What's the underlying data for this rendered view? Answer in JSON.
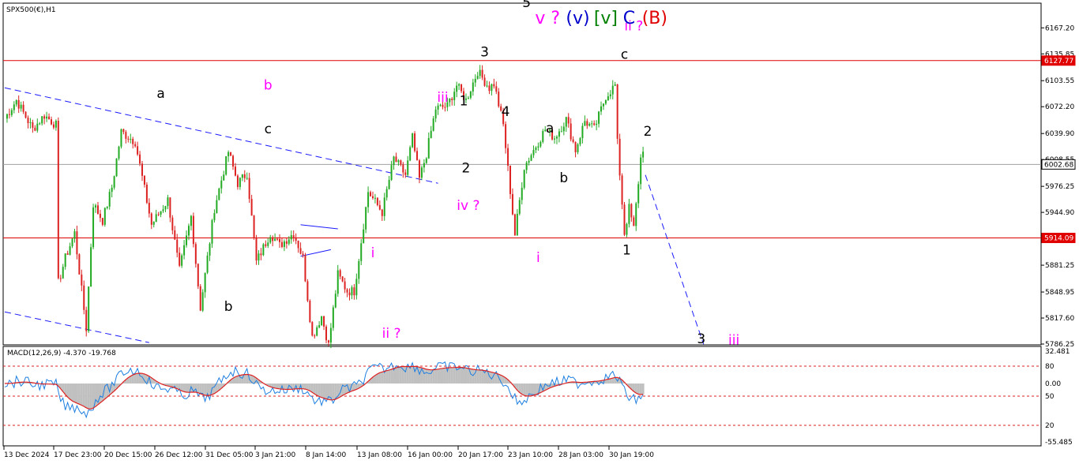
{
  "chart_data": {
    "type": "candlestick",
    "symbol_label": "SPX500(€),H1",
    "indicator_label": "MACD(12,26,9) -4.370 -19.768",
    "price_axis": {
      "ylim": [
        5786.25,
        6196.0
      ],
      "ticks": [
        "6167.20",
        "6135.85",
        "6103.55",
        "6072.20",
        "6039.90",
        "6008.55",
        "5976.25",
        "5944.90",
        "5914.09",
        "5881.25",
        "5848.95",
        "5817.60",
        "5786.25"
      ]
    },
    "macd_axis": {
      "tick_labels": [
        "32.481",
        "80",
        "0.00",
        "50",
        "20",
        "-55.485"
      ]
    },
    "time_axis": {
      "labels": [
        "13 Dec 2024",
        "17 Dec 23:00",
        "20 Dec 15:00",
        "26 Dec 12:00",
        "31 Dec 05:00",
        "3 Jan 21:00",
        "8 Jan 14:00",
        "13 Jan 08:00",
        "16 Jan 00:00",
        "20 Jan 17:00",
        "23 Jan 10:00",
        "28 Jan 03:00",
        "30 Jan 19:00"
      ]
    },
    "horizontal_lines": [
      {
        "label": "6127.77",
        "price": 6127.77,
        "color": "#e00000"
      },
      {
        "label": "6002.68",
        "price": 6002.68,
        "color": "#a0a0a0"
      },
      {
        "label": "5914.09",
        "price": 5914.09,
        "color": "#e00000"
      }
    ],
    "pivots": [
      [
        0,
        6058
      ],
      [
        5,
        6080
      ],
      [
        12,
        6045
      ],
      [
        17,
        6062
      ],
      [
        22,
        6050
      ],
      [
        23,
        5860
      ],
      [
        26,
        5890
      ],
      [
        30,
        5920
      ],
      [
        35,
        5805
      ],
      [
        38,
        5955
      ],
      [
        42,
        5935
      ],
      [
        46,
        5975
      ],
      [
        50,
        6042
      ],
      [
        56,
        6030
      ],
      [
        63,
        5930
      ],
      [
        70,
        5960
      ],
      [
        75,
        5875
      ],
      [
        80,
        5940
      ],
      [
        84,
        5830
      ],
      [
        90,
        5950
      ],
      [
        96,
        6018
      ],
      [
        100,
        5980
      ],
      [
        104,
        5992
      ],
      [
        108,
        5885
      ],
      [
        114,
        5920
      ],
      [
        118,
        5905
      ],
      [
        124,
        5920
      ],
      [
        128,
        5890
      ],
      [
        132,
        5795
      ],
      [
        136,
        5820
      ],
      [
        139,
        5785
      ],
      [
        143,
        5870
      ],
      [
        147,
        5850
      ],
      [
        150,
        5850
      ],
      [
        156,
        5970
      ],
      [
        162,
        5945
      ],
      [
        167,
        6010
      ],
      [
        172,
        5990
      ],
      [
        175,
        6035
      ],
      [
        178,
        5985
      ],
      [
        181,
        6015
      ],
      [
        185,
        6070
      ],
      [
        190,
        6073
      ],
      [
        194,
        6098
      ],
      [
        198,
        6080
      ],
      [
        203,
        6115
      ],
      [
        208,
        6095
      ],
      [
        210,
        6100
      ],
      [
        214,
        6050
      ],
      [
        219,
        5918
      ],
      [
        223,
        6000
      ],
      [
        227,
        6020
      ],
      [
        232,
        6045
      ],
      [
        236,
        6035
      ],
      [
        241,
        6057
      ],
      [
        245,
        6020
      ],
      [
        249,
        6055
      ],
      [
        253,
        6045
      ],
      [
        258,
        6085
      ],
      [
        262,
        6098
      ],
      [
        263,
        6028
      ],
      [
        266,
        5920
      ],
      [
        268,
        5950
      ],
      [
        270,
        5925
      ],
      [
        273,
        6010
      ],
      [
        274,
        6018
      ]
    ],
    "wave_labels": [
      {
        "text": "a",
        "x": 67,
        "price": 6083,
        "color": "#000000"
      },
      {
        "text": "b",
        "x": 113,
        "price": 6093,
        "color": "#ff00ff"
      },
      {
        "text": "c",
        "x": 113,
        "price": 6040,
        "color": "#000000"
      },
      {
        "text": "b",
        "x": 96,
        "price": 5826,
        "color": "#000000"
      },
      {
        "text": "i",
        "x": 158,
        "price": 5891,
        "color": "#ff00ff"
      },
      {
        "text": "ii ?",
        "x": 166,
        "price": 5794,
        "color": "#ff00ff"
      },
      {
        "text": "iii",
        "x": 188,
        "price": 6078,
        "color": "#ff00ff"
      },
      {
        "text": "1",
        "x": 197,
        "price": 6074,
        "color": "#000000"
      },
      {
        "text": "2",
        "x": 198,
        "price": 5993,
        "color": "#000000"
      },
      {
        "text": "iv ?",
        "x": 199,
        "price": 5948,
        "color": "#ff00ff"
      },
      {
        "text": "3",
        "x": 206,
        "price": 6133,
        "color": "#000000"
      },
      {
        "text": "4",
        "x": 215,
        "price": 6061,
        "color": "#000000"
      },
      {
        "text": "5",
        "x": 224,
        "price": 6192,
        "color": "#000000"
      },
      {
        "text": "i",
        "x": 229,
        "price": 5885,
        "color": "#ff00ff"
      },
      {
        "text": "a",
        "x": 234,
        "price": 6041,
        "color": "#000000"
      },
      {
        "text": "b",
        "x": 240,
        "price": 5981,
        "color": "#000000"
      },
      {
        "text": "c",
        "x": 266,
        "price": 6130,
        "color": "#000000"
      },
      {
        "text": "ii ?",
        "x": 270,
        "price": 6164,
        "color": "#ff00ff"
      },
      {
        "text": "2",
        "x": 276,
        "price": 6037,
        "color": "#000000"
      },
      {
        "text": "1",
        "x": 267,
        "price": 5894,
        "color": "#000000"
      },
      {
        "text": "3",
        "x": 299,
        "price": 5787,
        "color": "#000000"
      },
      {
        "text": "iii",
        "x": 313,
        "price": 5786,
        "color": "#ff00ff"
      }
    ],
    "top_labels": [
      {
        "text": "v ?",
        "x": 233,
        "color": "#ff00ff"
      },
      {
        "text": "(v)",
        "x": 246,
        "color": "#0000cc"
      },
      {
        "text": "[v]",
        "x": 258,
        "color": "#008000"
      },
      {
        "text": "C",
        "x": 268,
        "color": "#0000cc"
      },
      {
        "text": "(B)",
        "x": 279,
        "color": "#e00000"
      }
    ],
    "trendlines": [
      {
        "from": [
          0,
          6095
        ],
        "to": [
          186,
          5980
        ],
        "color": "#1a1aff",
        "dash": true
      },
      {
        "from": [
          0,
          5825
        ],
        "to": [
          62,
          5788
        ],
        "color": "#1a1aff",
        "dash": true
      },
      {
        "from": [
          127,
          5930
        ],
        "to": [
          143,
          5925
        ],
        "color": "#1a1aff",
        "dash": false
      },
      {
        "from": [
          127,
          5892
        ],
        "to": [
          140,
          5900
        ],
        "color": "#1a1aff",
        "dash": false
      },
      {
        "from": [
          275,
          5990
        ],
        "to": [
          300,
          5786
        ],
        "color": "#1a1aff",
        "dash": true
      }
    ]
  }
}
